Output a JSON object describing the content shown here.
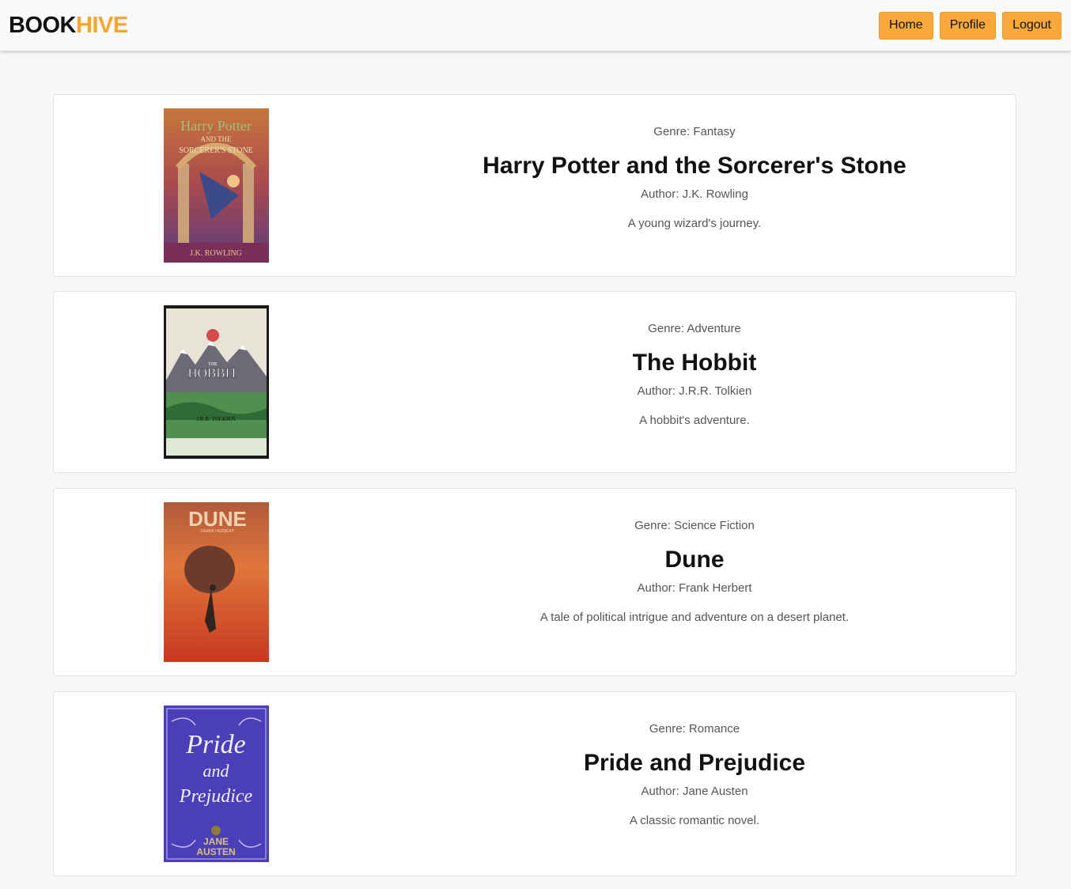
{
  "header": {
    "logo_part1": "BOOK",
    "logo_part2": "HIVE",
    "nav": {
      "home": "Home",
      "profile": "Profile",
      "logout": "Logout"
    }
  },
  "books": [
    {
      "genre": "Genre: Fantasy",
      "title": "Harry Potter and the Sorcerer's Stone",
      "author": "Author: J.K. Rowling",
      "description": "A young wizard's journey.",
      "cover": {
        "line1": "Harry Potter",
        "line2": "AND THE",
        "line3": "SORCERER'S STONE",
        "footer": "J.K. ROWLING"
      }
    },
    {
      "genre": "Genre: Adventure",
      "title": "The Hobbit",
      "author": "Author: J.R.R. Tolkien",
      "description": "A hobbit's adventure.",
      "cover": {
        "line1": "THE",
        "line2": "HOBBIT",
        "footer": "J.R.R. TOLKIEN"
      }
    },
    {
      "genre": "Genre: Science Fiction",
      "title": "Dune",
      "author": "Author: Frank Herbert",
      "description": "A tale of political intrigue and adventure on a desert planet.",
      "cover": {
        "line1": "DUNE",
        "line2": "FRANK HERBERT"
      }
    },
    {
      "genre": "Genre: Romance",
      "title": "Pride and Prejudice",
      "author": "Author: Jane Austen",
      "description": "A classic romantic novel.",
      "cover": {
        "line1": "Pride",
        "line2": "and",
        "line3": "Prejudice",
        "footer1": "JANE",
        "footer2": "AUSTEN"
      }
    }
  ]
}
